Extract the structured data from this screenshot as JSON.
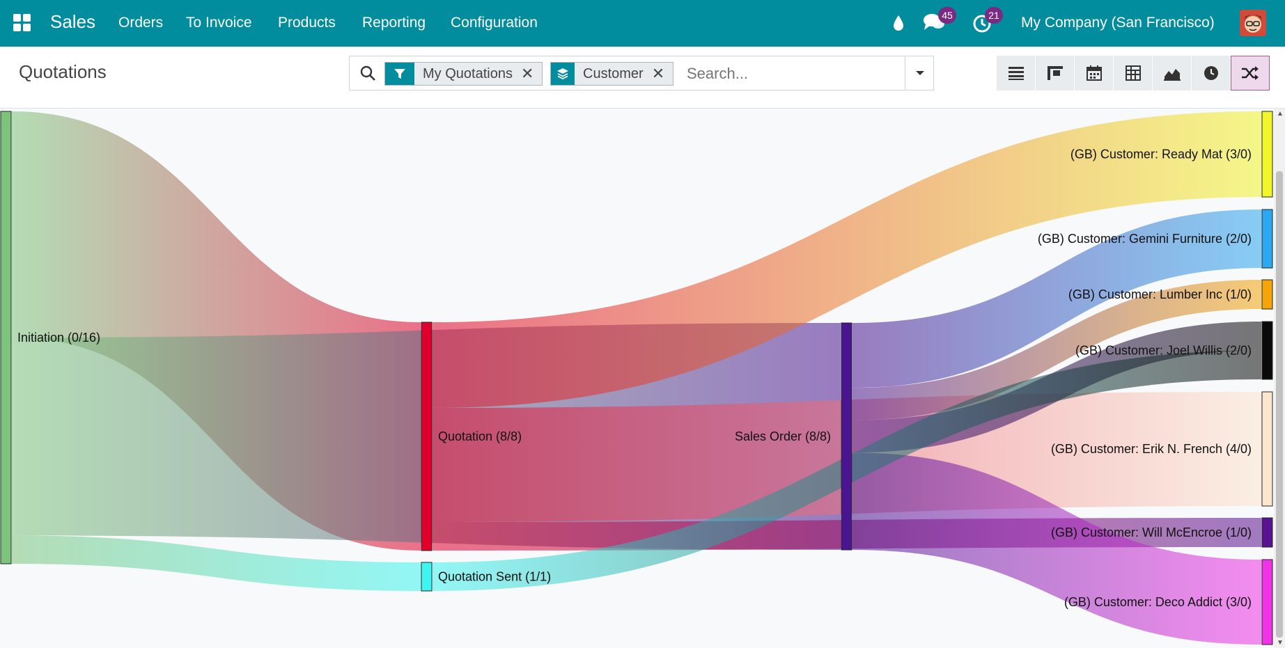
{
  "navbar": {
    "app_name": "Sales",
    "menu": [
      "Orders",
      "To Invoice",
      "Products",
      "Reporting",
      "Configuration"
    ],
    "messages_count": "45",
    "activities_count": "21",
    "company": "My Company (San Francisco)",
    "accent": "#018d9d",
    "badge_color": "#7b2a84"
  },
  "control_panel": {
    "title": "Quotations",
    "facets": [
      {
        "icon": "filter-icon",
        "label": "My Quotations"
      },
      {
        "icon": "layers-icon",
        "label": "Customer"
      }
    ],
    "search_placeholder": "Search...",
    "views": [
      "list-view-icon",
      "kanban-view-icon",
      "calendar-view-icon",
      "pivot-view-icon",
      "graph-view-icon",
      "activity-view-icon",
      "sankey-view-icon"
    ],
    "active_view": "sankey-view-icon"
  },
  "chart_data": {
    "type": "sankey",
    "nodes": [
      {
        "id": "init",
        "label": "Initiation (0/16)",
        "color": "#7cc47c"
      },
      {
        "id": "quot",
        "label": "Quotation (8/8)",
        "color": "#e0002b"
      },
      {
        "id": "sent",
        "label": "Quotation Sent (1/1)",
        "color": "#3ff5f0"
      },
      {
        "id": "so",
        "label": "Sales Order (8/8)",
        "color": "#4a1590"
      },
      {
        "id": "ready",
        "label": "(GB) Customer: Ready Mat (3/0)",
        "color": "#f2f52a"
      },
      {
        "id": "gemini",
        "label": "(GB) Customer: Gemini Furniture (2/0)",
        "color": "#2aa8f0"
      },
      {
        "id": "lumber",
        "label": "(GB) Customer: Lumber Inc (1/0)",
        "color": "#f5a50a"
      },
      {
        "id": "joel",
        "label": "(GB) Customer: Joel Willis (2/0)",
        "color": "#0a0a0a"
      },
      {
        "id": "erik",
        "label": "(GB) Customer: Erik N. French (4/0)",
        "color": "#fde6d0"
      },
      {
        "id": "will",
        "label": "(GB) Customer: Will McEncroe (1/0)",
        "color": "#5a1390"
      },
      {
        "id": "deco",
        "label": "(GB) Customer: Deco Addict (3/0)",
        "color": "#f033e6"
      }
    ],
    "links": [
      {
        "source": "init",
        "target": "quot",
        "value": 8
      },
      {
        "source": "init",
        "target": "so",
        "value": 7
      },
      {
        "source": "init",
        "target": "sent",
        "value": 1
      },
      {
        "source": "quot",
        "target": "ready",
        "value": 3
      },
      {
        "source": "quot",
        "target": "erik",
        "value": 4
      },
      {
        "source": "quot",
        "target": "will",
        "value": 1
      },
      {
        "source": "so",
        "target": "gemini",
        "value": 2
      },
      {
        "source": "so",
        "target": "lumber",
        "value": 1
      },
      {
        "source": "so",
        "target": "joel",
        "value": 1
      },
      {
        "source": "so",
        "target": "deco",
        "value": 3
      },
      {
        "source": "sent",
        "target": "joel",
        "value": 1
      }
    ]
  }
}
